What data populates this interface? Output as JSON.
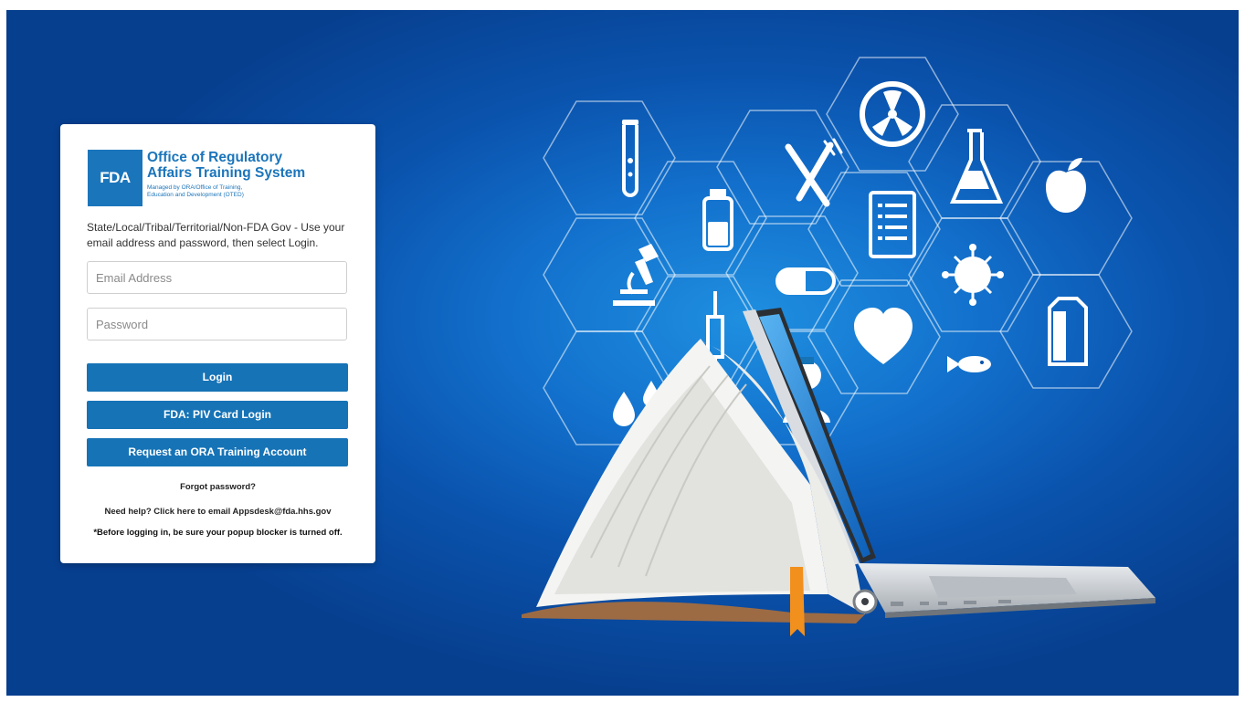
{
  "logo": {
    "mark": "FDA",
    "title_line1": "Office of Regulatory",
    "title_line2": "Affairs Training System",
    "subtitle_line1": "Managed by ORA/Office of Training,",
    "subtitle_line2": "Education and Development (OTED)"
  },
  "login": {
    "intro": "State/Local/Tribal/Territorial/Non-FDA Gov - Use your email address and password, then select Login.",
    "email_placeholder": "Email Address",
    "email_value": "",
    "password_placeholder": "Password",
    "password_value": "",
    "login_label": "Login",
    "piv_label": "FDA: PIV Card Login",
    "request_label": "Request an ORA Training Account",
    "forgot_label": "Forgot password?",
    "help_label": "Need help? Click here to email Appsdesk@fda.hhs.gov",
    "popup_note": "*Before logging in, be sure your popup blocker is turned off."
  },
  "hero": {
    "icons": [
      "test-tube-icon",
      "medicine-bottle-icon",
      "utensils-icon",
      "radiation-icon",
      "flask-icon",
      "apple-icon",
      "microscope-icon",
      "pill-icon",
      "document-icon",
      "virus-icon",
      "milk-carton-icon",
      "syringe-icon",
      "heart-icon",
      "fish-icon",
      "droplets-icon",
      "nurse-icon"
    ],
    "colors": {
      "background": "#0a53ad",
      "accent": "#1673b6",
      "bookmark": "#f2901e"
    }
  }
}
